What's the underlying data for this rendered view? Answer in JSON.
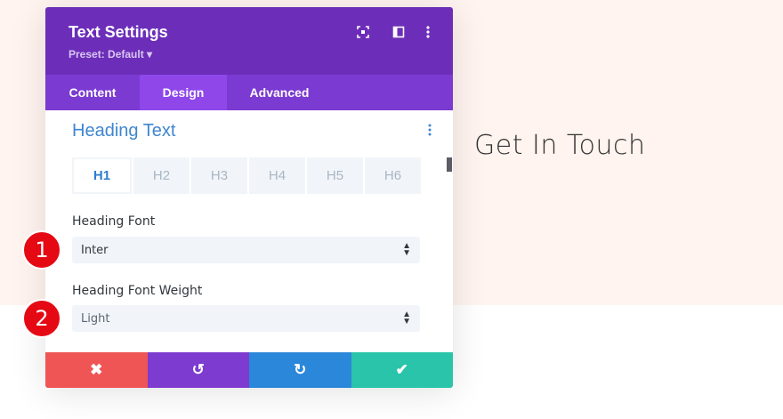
{
  "page": {
    "heading": "Get In Touch"
  },
  "modal": {
    "title": "Text Settings",
    "preset": "Preset: Default ▾",
    "header_icons": [
      "expand-icon",
      "sidebar-layout-icon",
      "more-vertical-icon"
    ],
    "tabs": [
      {
        "label": "Content",
        "active": false
      },
      {
        "label": "Design",
        "active": true
      },
      {
        "label": "Advanced",
        "active": false
      }
    ],
    "section": {
      "title": "Heading Text",
      "heading_tabs": [
        "H1",
        "H2",
        "H3",
        "H4",
        "H5",
        "H6"
      ],
      "active_heading_tab": "H1",
      "fields": [
        {
          "label": "Heading Font",
          "value": "Inter"
        },
        {
          "label": "Heading Font Weight",
          "value": "Light"
        }
      ]
    },
    "footer": {
      "buttons": [
        {
          "name": "cancel",
          "icon": "✖",
          "color": "#ef5555"
        },
        {
          "name": "undo",
          "icon": "↺",
          "color": "#7e3bd0"
        },
        {
          "name": "redo",
          "icon": "↻",
          "color": "#2b87da"
        },
        {
          "name": "save",
          "icon": "✔",
          "color": "#29c4a9"
        }
      ]
    }
  },
  "annotations": [
    "1",
    "2"
  ],
  "colors": {
    "header": "#6c2eb9",
    "tabs": "#7b3ad1",
    "active_tab": "#8f47ea",
    "accent_blue": "#3f86d0",
    "badge_red": "#e50914"
  }
}
